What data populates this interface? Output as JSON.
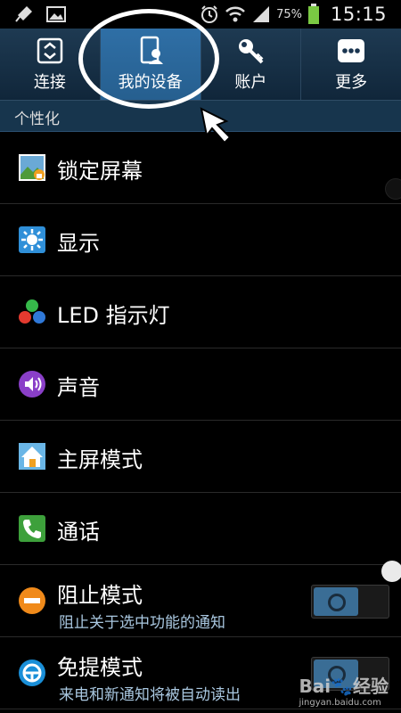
{
  "status_bar": {
    "left_icons": [
      "cleaner-icon",
      "image-icon"
    ],
    "battery_percent": "75%",
    "time": "15:15"
  },
  "tabs": [
    {
      "label": "连接",
      "icon": "connections-icon",
      "active": false
    },
    {
      "label": "我的设备",
      "icon": "my-device-icon",
      "active": true
    },
    {
      "label": "账户",
      "icon": "key-icon",
      "active": false
    },
    {
      "label": "更多",
      "icon": "more-icon",
      "active": false
    }
  ],
  "section": {
    "title": "个性化"
  },
  "items": [
    {
      "label": "锁定屏幕",
      "icon": "lock-screen-icon"
    },
    {
      "label": "显示",
      "icon": "display-icon"
    },
    {
      "label": "LED 指示灯",
      "icon": "led-indicator-icon"
    },
    {
      "label": "声音",
      "icon": "sound-icon"
    },
    {
      "label": "主屏模式",
      "icon": "home-screen-icon"
    },
    {
      "label": "通话",
      "icon": "call-icon"
    },
    {
      "label": "阻止模式",
      "sub": "阻止关于选中功能的通知",
      "icon": "blocking-mode-icon",
      "toggle": true
    },
    {
      "label": "免提模式",
      "sub": "来电和新通知将被自动读出",
      "icon": "hands-free-icon",
      "toggle": true
    }
  ],
  "watermark": {
    "brand": "Bai",
    "brand2": "经验",
    "url": "jingyan.baidu.com"
  },
  "colors": {
    "tab_active": "#2f6fa6",
    "tab_bar": "#1e3a52",
    "section": "#17354d",
    "subtitle": "#a9c7e0"
  }
}
